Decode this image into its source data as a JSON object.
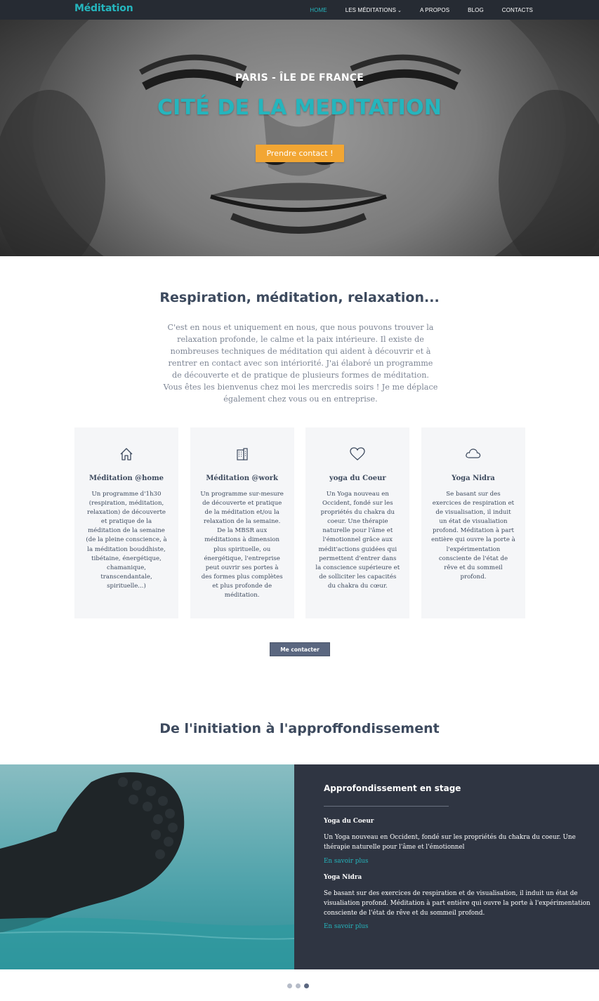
{
  "brand": {
    "name": "Méditation",
    "color": "#25b5bd"
  },
  "nav": {
    "items": [
      {
        "label": "HOME",
        "active": true
      },
      {
        "label": "LES MÉDITATIONS",
        "has_dropdown": true
      },
      {
        "label": "A PROPOS"
      },
      {
        "label": "BLOG"
      },
      {
        "label": "CONTACTS"
      }
    ]
  },
  "hero": {
    "subtitle": "PARIS - ÎLE DE FRANCE",
    "title": "CITÉ DE LA MEDITATION",
    "button": "Prendre contact !"
  },
  "intro": {
    "title": "Respiration, méditation, relaxation...",
    "text": "C'est en nous et uniquement en nous, que nous pouvons trouver la relaxation profonde, le calme et la paix intérieure. Il existe de nombreuses techniques de méditation qui aident à découvrir et à rentrer en contact avec son intériorité. J'ai élaboré un programme de découverte et de pratique de plusieurs formes de méditation. Vous êtes les bienvenus chez moi les mercredis soirs ! Je me déplace également chez vous ou en entreprise."
  },
  "cards": [
    {
      "icon": "home-icon",
      "title": "Méditation @home",
      "text": "Un programme d'1h30 (respiration, méditation, relaxation) de découverte et pratique de la méditation de la semaine (de la pleine conscience, à la méditation bouddhiste, tibétaine, énergétique, chamanique, transcendantale, spirituelle...)"
    },
    {
      "icon": "building-icon",
      "title": "Méditation @work",
      "text": "Un programme sur-mesure de découverte et pratique de la méditation et/ou la relaxation de la semaine. De la MBSR aux méditations à dimension plus spirituelle, ou énergétique, l'entreprise peut ouvrir ses portes à des formes plus complètes et plus profonde de méditation."
    },
    {
      "icon": "heart-icon",
      "title": "yoga du Coeur",
      "text": "Un Yoga nouveau en Occident, fondé sur les propriétés du chakra du coeur. Une thérapie naturelle pour l'âme et l'émotionnel grâce aux médit'actions guidées qui permettent d'entrer dans la conscience supérieure et de solliciter les capacités du chakra du cœur."
    },
    {
      "icon": "cloud-icon",
      "title": "Yoga Nidra",
      "text": "Se basant sur des exercices de respiration et de visualisation, il induit un état de visualiation profond. Méditation à part entière qui ouvre la porte à l'expérimentation consciente de l'état de rêve et du sommeil profond."
    }
  ],
  "contact_button": "Me contacter",
  "section2": {
    "title": "De l'initiation à l'approffondissement",
    "panel": {
      "title": "Approfondissement en stage",
      "items": [
        {
          "subtitle": "Yoga du Coeur",
          "text": "Un Yoga nouveau en Occident, fondé sur les propriétés du chakra du coeur. Une thérapie naturelle pour l'âme et l'émotionnel",
          "link": "En savoir plus"
        },
        {
          "subtitle": "Yoga Nidra",
          "text": "Se basant sur des exercices de respiration et de visualisation, il induit un état de visualiation profond. Méditation à part entière qui ouvre la porte à l'expérimentation consciente de l'état de rêve et du sommeil profond.",
          "link": "En savoir plus"
        }
      ]
    },
    "carousel": {
      "count": 3,
      "active_index": 3
    }
  }
}
